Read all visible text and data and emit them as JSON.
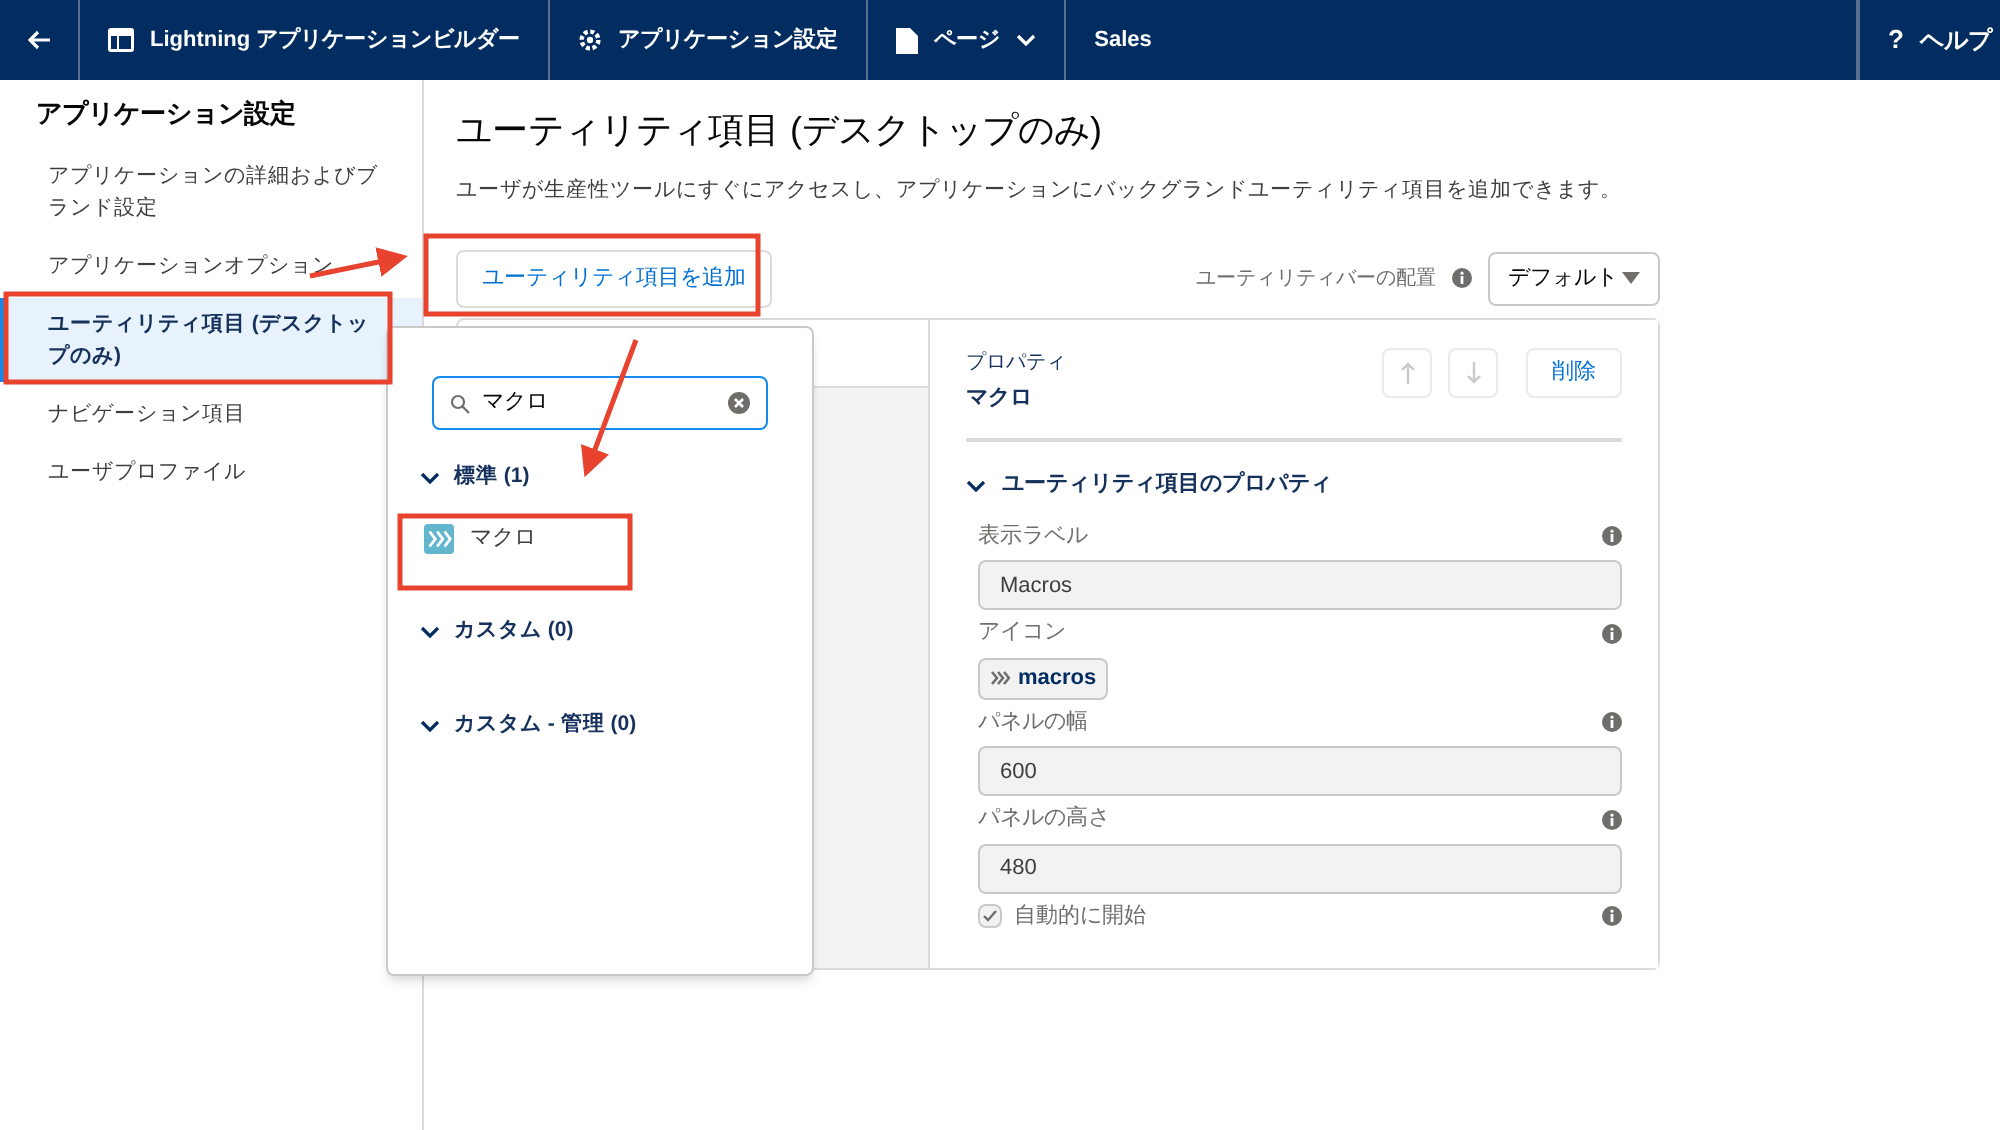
{
  "header": {
    "items": [
      {
        "kind": "app",
        "label": "Lightning アプリケーションビルダー"
      },
      {
        "kind": "settings",
        "label": "アプリケーション設定"
      },
      {
        "kind": "menu",
        "label": "ページ"
      },
      {
        "kind": "plain",
        "label": "Sales"
      }
    ],
    "help_icon": "?",
    "help": "ヘルプ"
  },
  "sidebar": {
    "title": "アプリケーション設定",
    "items": [
      {
        "label": "アプリケーションの詳細およびブランド設定",
        "selected": false
      },
      {
        "label": "アプリケーションオプション",
        "selected": false
      },
      {
        "label": "ユーティリティ項目 (デスクトップのみ)",
        "selected": true
      },
      {
        "label": "ナビゲーション項目",
        "selected": false
      },
      {
        "label": "ユーザプロファイル",
        "selected": false
      }
    ]
  },
  "main": {
    "title": "ユーティリティ項目 (デスクトップのみ)",
    "description": "ユーザが生産性ツールにすぐにアクセスし、アプリケーションにバックグランドユーティリティ項目を追加できます。",
    "add_button": "ユーティリティ項目を追加",
    "placement": {
      "label": "ユーティリティバーの配置",
      "value": "デフォルト"
    }
  },
  "popover": {
    "search": {
      "value": "マクロ"
    },
    "groups": [
      {
        "label": "標準 (1)",
        "expanded": true,
        "items": [
          {
            "label": "マクロ"
          }
        ]
      },
      {
        "label": "カスタム (0)",
        "expanded": true
      },
      {
        "label": "カスタム - 管理 (0)",
        "expanded": true
      }
    ]
  },
  "properties": {
    "heading": "プロパティ",
    "name": "マクロ",
    "delete": "削除",
    "section": {
      "title": "ユーティリティ項目のプロパティ",
      "expanded": true
    },
    "fields": [
      {
        "kind": "text",
        "label": "表示ラベル",
        "value": "Macros"
      },
      {
        "kind": "icon",
        "label": "アイコン",
        "value": "macros"
      },
      {
        "kind": "text",
        "label": "パネルの幅",
        "value": "600"
      },
      {
        "kind": "text",
        "label": "パネルの高さ",
        "value": "480"
      },
      {
        "kind": "checkbox",
        "label": "自動的に開始",
        "checked": true
      }
    ]
  }
}
